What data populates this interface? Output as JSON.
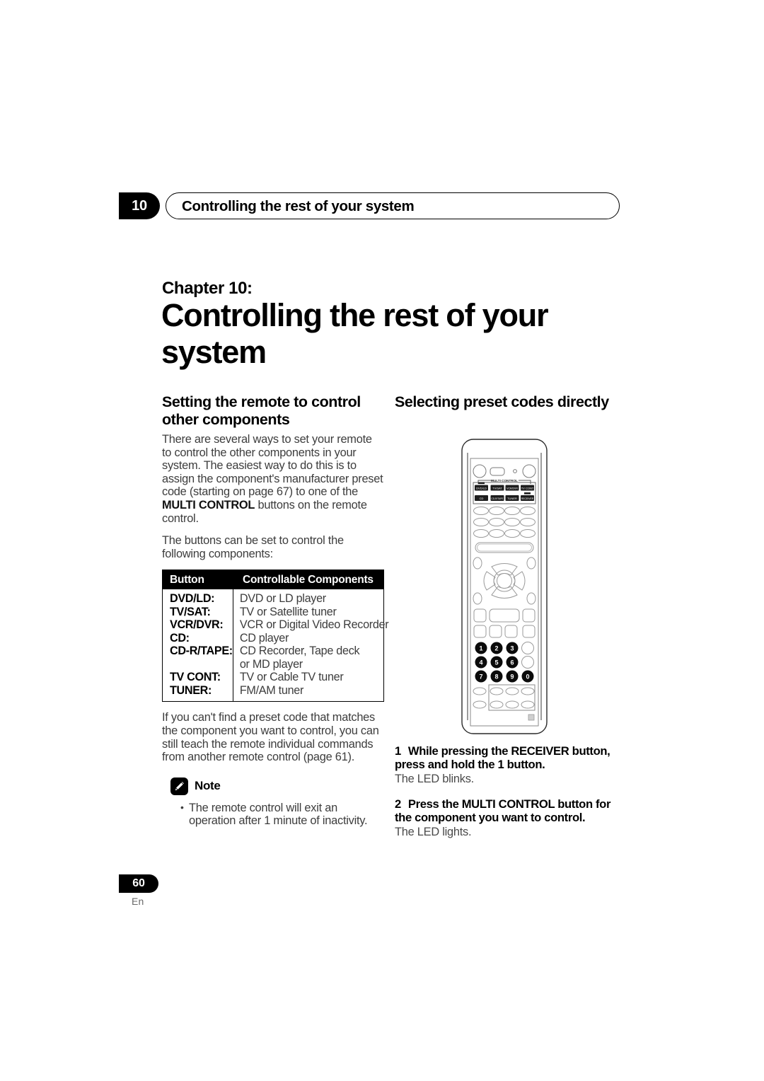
{
  "running_header": {
    "chapter_number": "10",
    "title": "Controlling the rest of your system"
  },
  "chapter": {
    "label": "Chapter 10:",
    "title": "Controlling the rest of your system"
  },
  "left_column": {
    "heading": "Setting the remote to control other components",
    "para1_a": "There are several ways to set your remote to control the other components in your system. The easiest way to do this is to assign the component's manufacturer preset code (starting on page 67) to one of the ",
    "para1_bold1": "MULTI CONTROL",
    "para1_b": " buttons on the remote control.",
    "para2": "The buttons can be set to control the following components:",
    "table": {
      "headers": [
        "Button",
        "Controllable Components"
      ],
      "rows": [
        {
          "button": "DVD/LD:",
          "components": "DVD or LD player"
        },
        {
          "button": "TV/SAT:",
          "components": "TV or Satellite tuner"
        },
        {
          "button": "VCR/DVR:",
          "components": "VCR or Digital Video Recorder"
        },
        {
          "button": "CD:",
          "components": "CD player"
        },
        {
          "button": "CD-R/TAPE:",
          "components": "CD Recorder, Tape deck"
        },
        {
          "button": "",
          "components": "or MD player"
        },
        {
          "button": "TV CONT:",
          "components": "TV or Cable TV tuner"
        },
        {
          "button": "TUNER:",
          "components": "FM/AM tuner"
        }
      ]
    },
    "para3": "If you can't find a preset code that matches the component you want to control, you can still teach the remote individual commands from another remote control (page 61).",
    "note": {
      "label": "Note",
      "icon": "pencil-note-icon",
      "bullets": [
        "The remote control will exit an operation after 1 minute of inactivity."
      ]
    }
  },
  "right_column": {
    "heading": "Selecting preset codes directly",
    "steps": [
      {
        "number": "1",
        "text": "While pressing the RECEIVER button, press and hold the 1 button.",
        "result": "The LED blinks."
      },
      {
        "number": "2",
        "text": "Press the MULTI CONTROL button for the component you want to control.",
        "result": "The LED lights."
      }
    ],
    "remote_illustration": {
      "section_label": "MULTI CONTROL",
      "multi_control_buttons_row1": [
        "DVD/LD",
        "TV/SAT",
        "VCR/DVR",
        "TV CONT"
      ],
      "multi_control_buttons_row2": [
        "CD",
        "CD-R/TAPE",
        "TUNER",
        "RECEIVER"
      ],
      "numeric_keys": [
        "1",
        "2",
        "3",
        "4",
        "5",
        "6",
        "7",
        "8",
        "9",
        "0"
      ],
      "highlighted_keys": [
        "1",
        "2",
        "3",
        "4",
        "5",
        "6",
        "7",
        "8",
        "9",
        "0"
      ]
    }
  },
  "footer": {
    "page_number": "60",
    "language": "En"
  },
  "colors": {
    "ink": "#000000",
    "body_text": "#3d3d3d",
    "page_background": "#ffffff"
  }
}
